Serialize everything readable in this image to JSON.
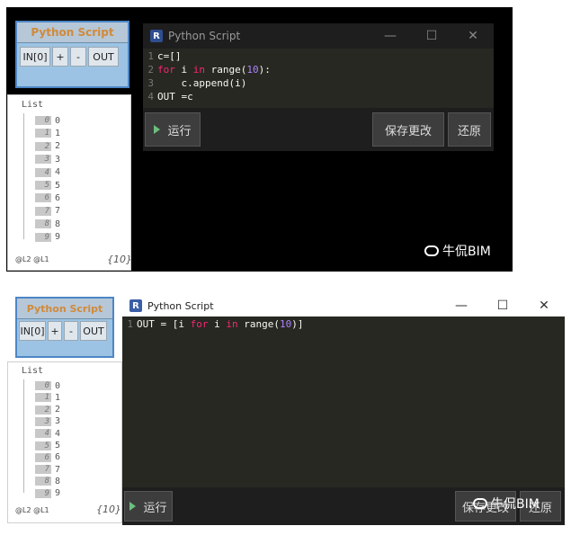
{
  "top": {
    "node": {
      "title": "Python Script",
      "in_port": "IN[0]",
      "plus": "+",
      "minus": "-",
      "out_port": "OUT"
    },
    "watch": {
      "title": "List",
      "items": [
        {
          "index": "0",
          "value": "0"
        },
        {
          "index": "1",
          "value": "1"
        },
        {
          "index": "2",
          "value": "2"
        },
        {
          "index": "3",
          "value": "3"
        },
        {
          "index": "4",
          "value": "4"
        },
        {
          "index": "5",
          "value": "5"
        },
        {
          "index": "6",
          "value": "6"
        },
        {
          "index": "7",
          "value": "7"
        },
        {
          "index": "8",
          "value": "8"
        },
        {
          "index": "9",
          "value": "9"
        }
      ],
      "levels": "@L2 @L1",
      "count": "{10}"
    },
    "editor": {
      "title": "Python Script",
      "app_icon": "R",
      "minimize": "—",
      "maximize": "☐",
      "close": "✕",
      "code": [
        {
          "num": "1",
          "text": "c=[]"
        },
        {
          "num": "2",
          "text": "for i in range(10):"
        },
        {
          "num": "3",
          "text": "    c.append(i)"
        },
        {
          "num": "4",
          "text": "OUT =c"
        }
      ],
      "run_label": "运行",
      "save_label": "保存更改",
      "revert_label": "还原"
    },
    "watermark": "牛侃BIM"
  },
  "bottom": {
    "node": {
      "title": "Python Script",
      "in_port": "IN[0]",
      "plus": "+",
      "minus": "-",
      "out_port": "OUT"
    },
    "watch": {
      "title": "List",
      "items": [
        {
          "index": "0",
          "value": "0"
        },
        {
          "index": "1",
          "value": "1"
        },
        {
          "index": "2",
          "value": "2"
        },
        {
          "index": "3",
          "value": "3"
        },
        {
          "index": "4",
          "value": "4"
        },
        {
          "index": "5",
          "value": "5"
        },
        {
          "index": "6",
          "value": "6"
        },
        {
          "index": "7",
          "value": "7"
        },
        {
          "index": "8",
          "value": "8"
        },
        {
          "index": "9",
          "value": "9"
        }
      ],
      "levels": "@L2 @L1",
      "count": "{10}"
    },
    "editor": {
      "title": "Python Script",
      "app_icon": "R",
      "minimize": "—",
      "maximize": "☐",
      "close": "✕",
      "code": [
        {
          "num": "1",
          "text": "OUT = [i for i in range(10)]"
        }
      ],
      "run_label": "运行",
      "save_label": "保存更改",
      "revert_label": "还原"
    },
    "watermark": "牛侃BIM"
  },
  "colors": {
    "keyword": "#f92672",
    "number": "#ae81ff",
    "node_title": "#d08a3a",
    "node_border": "#4d86c6"
  }
}
